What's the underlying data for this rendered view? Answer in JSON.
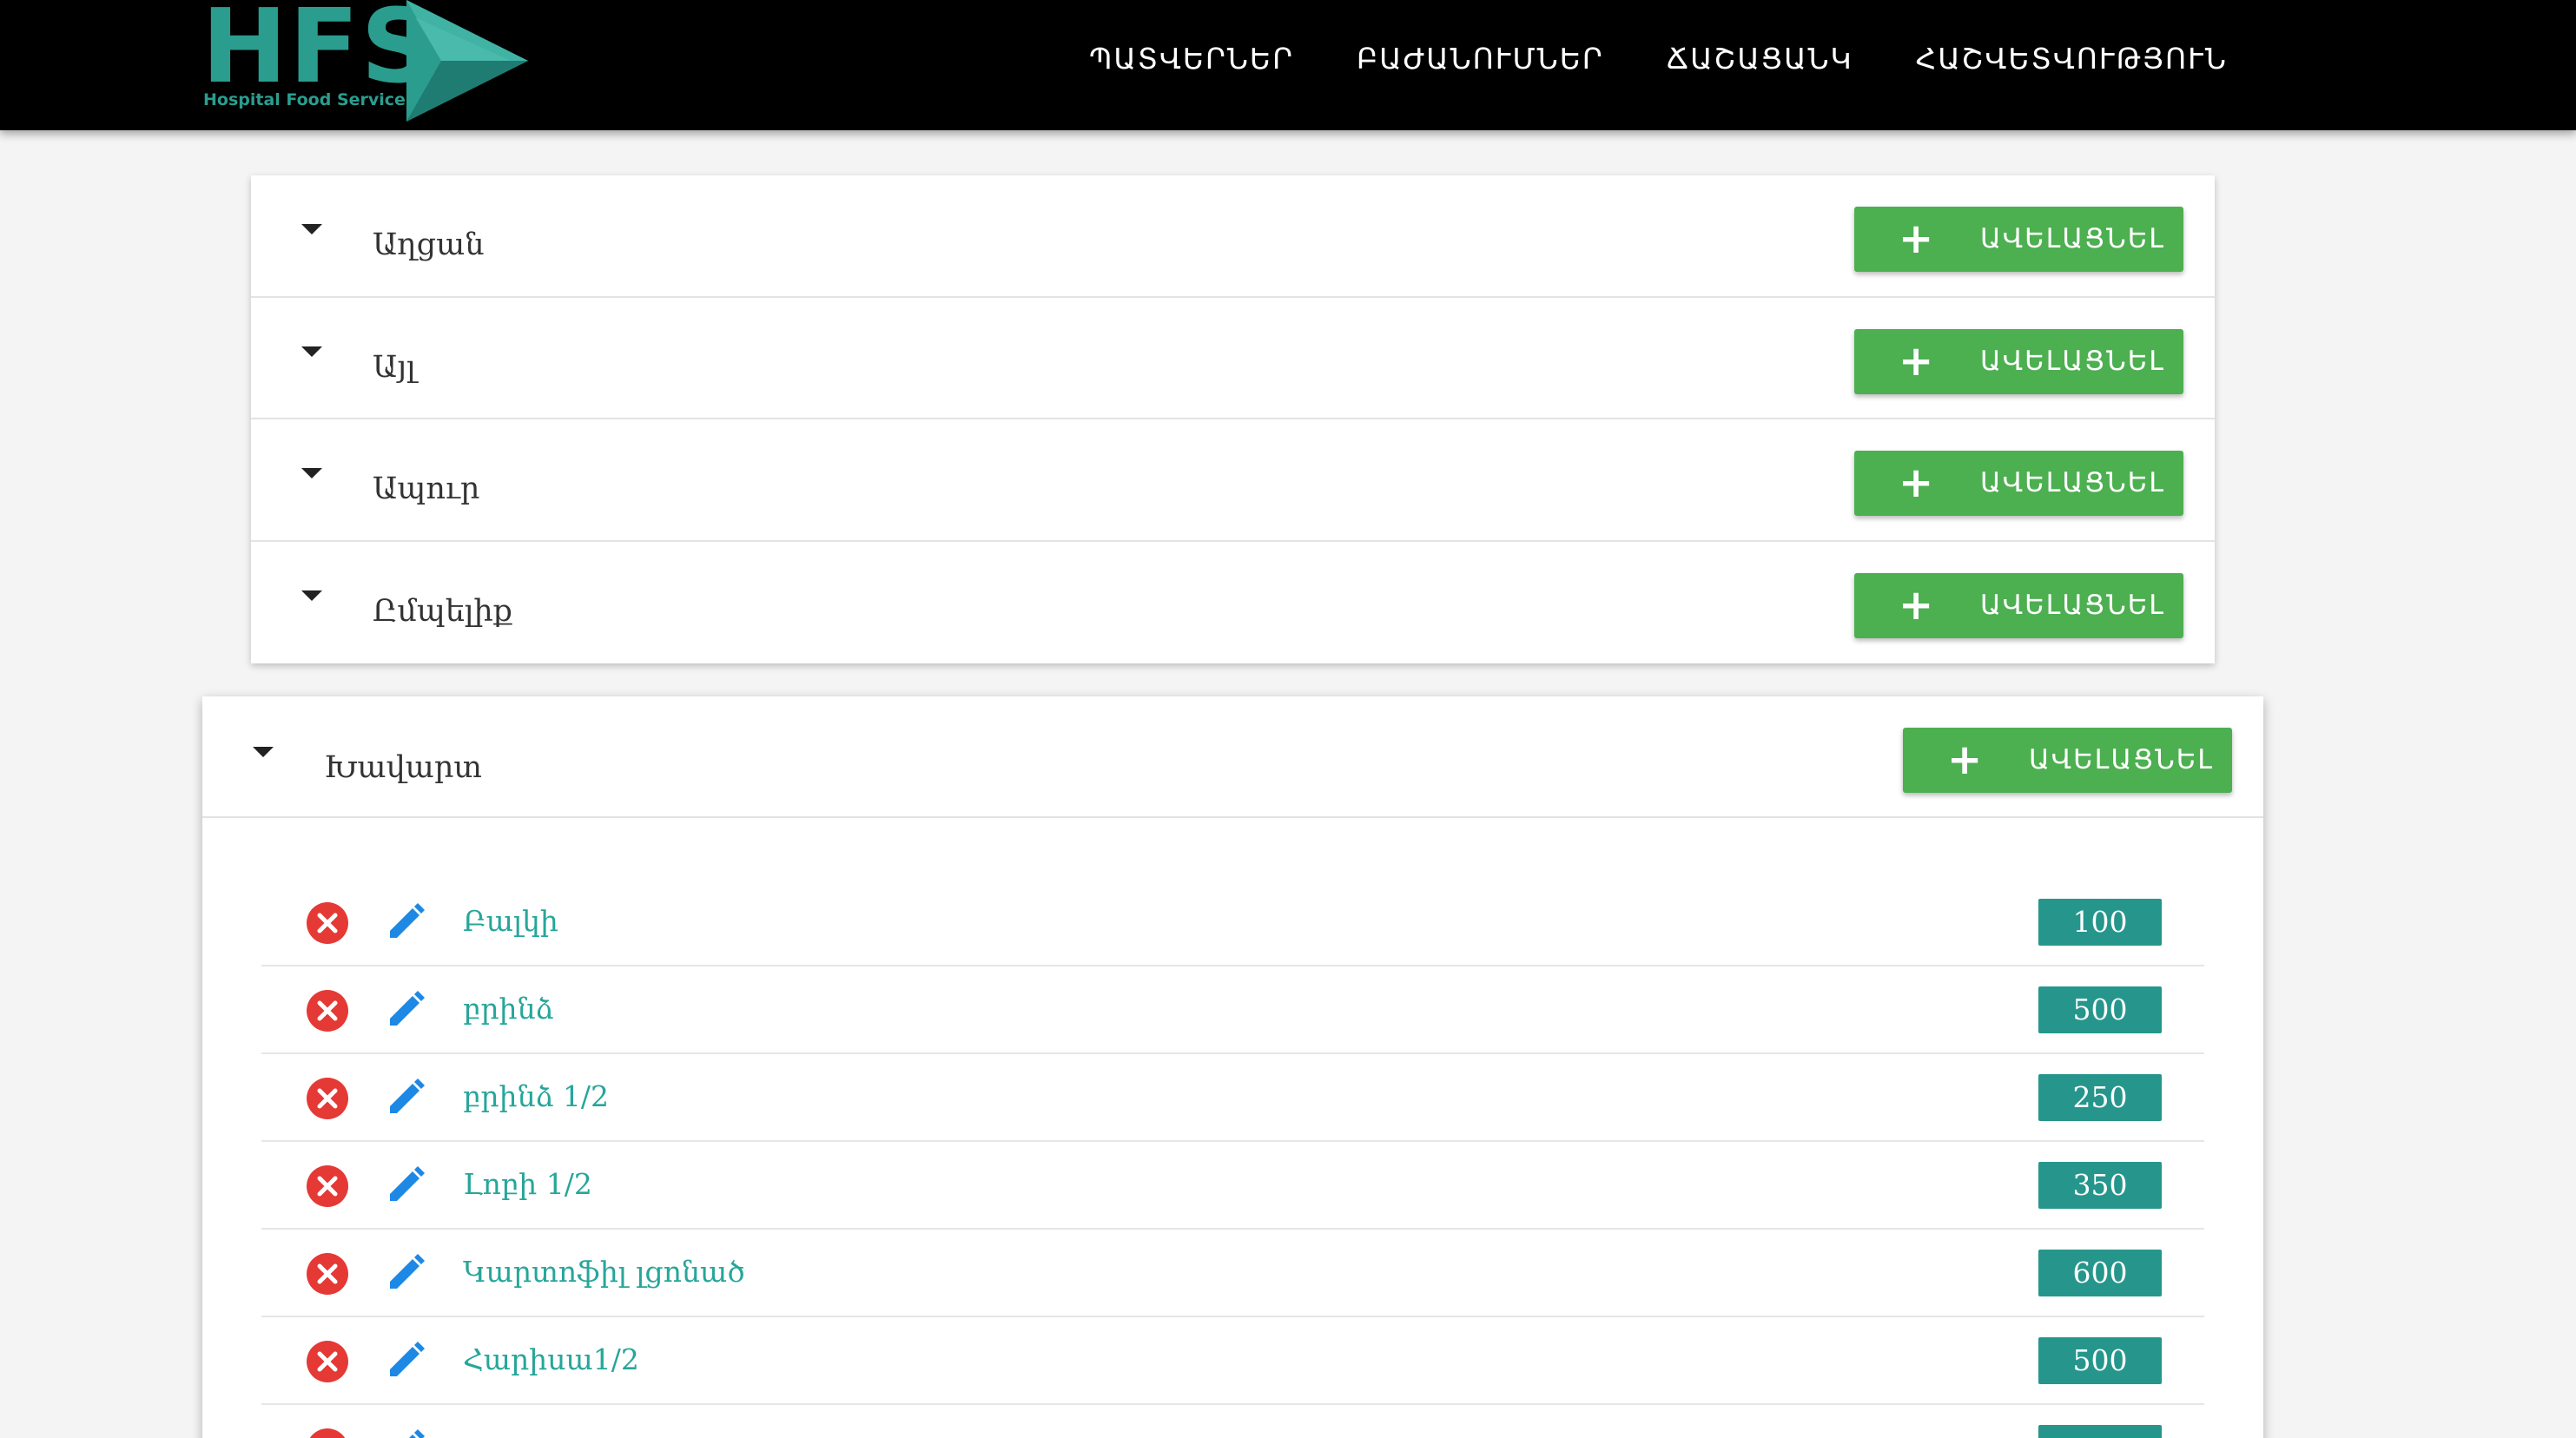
{
  "brand": {
    "logo_text": "HFS",
    "logo_subtitle": "Hospital Food Service",
    "accent_color": "#2a9d8f"
  },
  "nav": {
    "items": [
      {
        "label": "ՊԱՏՎԵՐՆԵՐ"
      },
      {
        "label": "ԲԱԺԱՆՈՒՄՆԵՐ"
      },
      {
        "label": "ՃԱՇԱՑԱՆԿ"
      },
      {
        "label": "ՀԱՇՎԵՏՎՈՒԹՅՈՒՆ"
      }
    ]
  },
  "add_button": {
    "icon": "plus-icon",
    "label": "ԱՎԵԼԱՑՆԵԼ",
    "color": "#4caf50"
  },
  "categories": [
    {
      "name": "Աղցան"
    },
    {
      "name": "Այլ"
    },
    {
      "name": "Ապուր"
    },
    {
      "name": "Ըմպելիք"
    }
  ],
  "expanded_category": {
    "name": "Խավարտ",
    "items": [
      {
        "name": "Բալկի",
        "price": "100"
      },
      {
        "name": "բրինձ",
        "price": "500"
      },
      {
        "name": "բրինձ 1/2",
        "price": "250"
      },
      {
        "name": "Լոբի 1/2",
        "price": "350"
      },
      {
        "name": "Կարտոֆիլ լցոնած",
        "price": "600"
      },
      {
        "name": "Հարիսա1/2",
        "price": "500"
      },
      {
        "name": "",
        "price": ""
      }
    ]
  },
  "colors": {
    "delete_icon": "#e53935",
    "edit_icon": "#1e88e5",
    "item_text": "#26a69a",
    "price_badge": "#26968c",
    "navbar_bg": "#000000"
  }
}
